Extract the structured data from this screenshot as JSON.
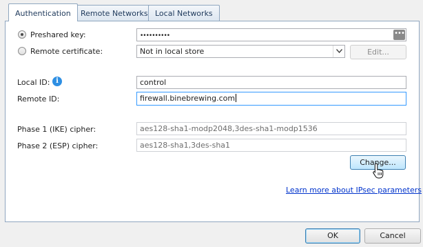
{
  "tabs": [
    {
      "label": "Authentication",
      "active": true
    },
    {
      "label": "Remote Networks",
      "active": false
    },
    {
      "label": "Local Networks",
      "active": false
    }
  ],
  "auth": {
    "preshared_label": "Preshared key:",
    "preshared_value": "••••••••••",
    "preshared_selected": true,
    "remote_cert_label": "Remote certificate:",
    "remote_cert_value": "Not in local store",
    "edit_label": "Edit...",
    "local_id_label": "Local ID:",
    "local_id_value": "control",
    "remote_id_label": "Remote ID:",
    "remote_id_value": "firewall.binebrewing.com",
    "phase1_label": "Phase 1 (IKE) cipher:",
    "phase1_value": "aes128-sha1-modp2048,3des-sha1-modp1536",
    "phase2_label": "Phase 2 (ESP) cipher:",
    "phase2_value": "aes128-sha1,3des-sha1",
    "change_label": "Change...",
    "learn_more_label": "Learn more about IPsec parameters"
  },
  "buttons": {
    "ok": "OK",
    "cancel": "Cancel"
  },
  "colors": {
    "tab_border": "#8fa6bf",
    "focus_border": "#3399ff",
    "link": "#0033cc",
    "info_icon": "#2e8fe3"
  }
}
